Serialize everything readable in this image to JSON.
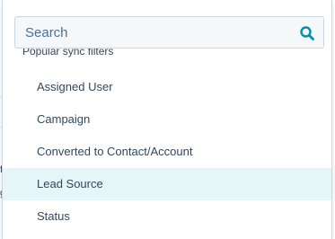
{
  "search": {
    "placeholder": "Search",
    "value": ""
  },
  "group": {
    "header": "Popular sync filters"
  },
  "options": [
    {
      "label": "Assigned User",
      "highlighted": false
    },
    {
      "label": "Campaign",
      "highlighted": false
    },
    {
      "label": "Converted to Contact/Account",
      "highlighted": false
    },
    {
      "label": "Lead Source",
      "highlighted": true
    },
    {
      "label": "Status",
      "highlighted": false
    }
  ],
  "colors": {
    "highlight": "#e5f5f8",
    "accent": "#0091ae",
    "text": "#33475b",
    "border": "#cbd6e2"
  },
  "background_fragments": [
    "f",
    "g"
  ]
}
